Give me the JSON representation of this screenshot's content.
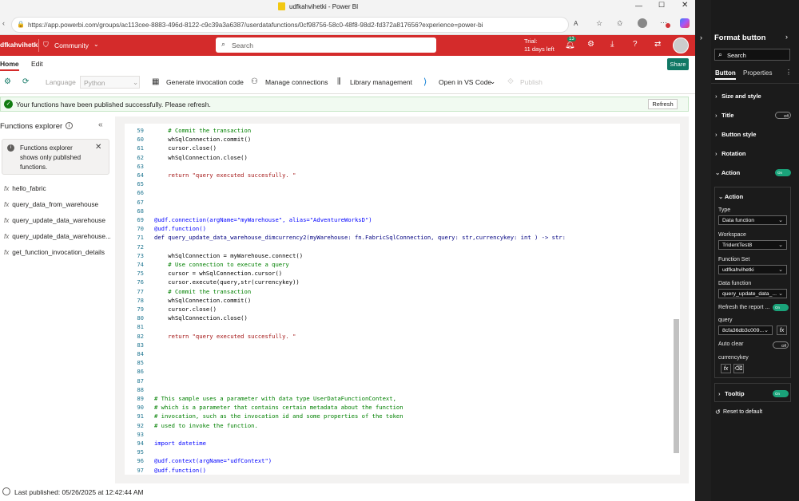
{
  "window": {
    "title": "udfkahvihetki - Power BI"
  },
  "browser": {
    "url": "https://app.powerbi.com/groups/ac113cee-8883-496d-8122-c9c39a3a6387/userdatafunctions/0cf98756-58c0-48f8-98d2-fd372a817656?experience=power-bi",
    "notify_count": "13"
  },
  "appbar": {
    "workspace": "dfkahvihetki",
    "community": "Community",
    "search_placeholder": "Search",
    "trial_line1": "Trial:",
    "trial_line2": "11 days left",
    "notif_count": "13",
    "share": "Share"
  },
  "menu": {
    "home": "Home",
    "edit": "Edit"
  },
  "ribbon": {
    "language_label": "Language",
    "language_value": "Python",
    "generate": "Generate invocation code",
    "connections": "Manage connections",
    "library": "Library management",
    "vscode": "Open in VS Code",
    "publish": "Publish"
  },
  "banner": {
    "text": "Your functions have been published successfully. Please refresh.",
    "refresh": "Refresh"
  },
  "explorer": {
    "title": "Functions explorer",
    "info": [
      "Functions explorer",
      "shows only published",
      "functions."
    ],
    "functions": [
      "hello_fabric",
      "query_data_from_warehouse",
      "query_update_data_warehouse",
      "query_update_data_warehouse...",
      "get_function_invocation_details"
    ]
  },
  "code": [
    {
      "n": "59",
      "t": "    # Commit the transaction",
      "k": "cm"
    },
    {
      "n": "60",
      "t": "    whSqlConnection.commit()",
      "k": ""
    },
    {
      "n": "61",
      "t": "    cursor.close()",
      "k": ""
    },
    {
      "n": "62",
      "t": "    whSqlConnection.close()",
      "k": ""
    },
    {
      "n": "63",
      "t": "",
      "k": ""
    },
    {
      "n": "64",
      "t": "    return \"query executed succesfully. \"",
      "k": "ret"
    },
    {
      "n": "65",
      "t": "",
      "k": ""
    },
    {
      "n": "66",
      "t": "",
      "k": ""
    },
    {
      "n": "67",
      "t": "",
      "k": ""
    },
    {
      "n": "68",
      "t": "",
      "k": ""
    },
    {
      "n": "69",
      "t": "@udf.connection(argName=\"myWarehouse\", alias=\"AdventureWorksD\")",
      "k": "dec"
    },
    {
      "n": "70",
      "t": "@udf.function()",
      "k": "dec"
    },
    {
      "n": "71",
      "t": "def query_update_data_warehouse_dimcurrency2(myWarehouse: fn.FabricSqlConnection, query: str,currencykey: int ) -> str:",
      "k": "def"
    },
    {
      "n": "72",
      "t": "",
      "k": ""
    },
    {
      "n": "73",
      "t": "    whSqlConnection = myWarehouse.connect()",
      "k": ""
    },
    {
      "n": "74",
      "t": "    # Use connection to execute a query",
      "k": "cm"
    },
    {
      "n": "75",
      "t": "    cursor = whSqlConnection.cursor()",
      "k": ""
    },
    {
      "n": "76",
      "t": "    cursor.execute(query,str(currencykey))",
      "k": ""
    },
    {
      "n": "77",
      "t": "    # Commit the transaction",
      "k": "cm"
    },
    {
      "n": "78",
      "t": "    whSqlConnection.commit()",
      "k": ""
    },
    {
      "n": "79",
      "t": "    cursor.close()",
      "k": ""
    },
    {
      "n": "80",
      "t": "    whSqlConnection.close()",
      "k": ""
    },
    {
      "n": "81",
      "t": "",
      "k": ""
    },
    {
      "n": "82",
      "t": "    return \"query executed succesfully. \"",
      "k": "ret"
    },
    {
      "n": "83",
      "t": "",
      "k": ""
    },
    {
      "n": "84",
      "t": "",
      "k": ""
    },
    {
      "n": "85",
      "t": "",
      "k": ""
    },
    {
      "n": "86",
      "t": "",
      "k": ""
    },
    {
      "n": "87",
      "t": "",
      "k": ""
    },
    {
      "n": "88",
      "t": "",
      "k": ""
    },
    {
      "n": "89",
      "t": "# This sample uses a parameter with data type UserDataFunctionContext,",
      "k": "cm"
    },
    {
      "n": "90",
      "t": "# which is a parameter that contains certain metadata about the function",
      "k": "cm"
    },
    {
      "n": "91",
      "t": "# invocation, such as the invocation id and some properties of the token",
      "k": "cm"
    },
    {
      "n": "92",
      "t": "# used to invoke the function.",
      "k": "cm"
    },
    {
      "n": "93",
      "t": "",
      "k": ""
    },
    {
      "n": "94",
      "t": "import datetime",
      "k": "imp"
    },
    {
      "n": "95",
      "t": "",
      "k": ""
    },
    {
      "n": "96",
      "t": "@udf.context(argName=\"udfContext\")",
      "k": "dec"
    },
    {
      "n": "97",
      "t": "@udf.function()",
      "k": "dec"
    }
  ],
  "status": {
    "text": "Last published: 05/26/2025 at 12:42:44 AM"
  },
  "pane": {
    "title": "Format button",
    "search": "Search",
    "tab_button": "Button",
    "tab_properties": "Properties",
    "size_style": "Size and style",
    "title_sec": "Title",
    "button_style": "Button style",
    "rotation": "Rotation",
    "action": "Action",
    "action_inner": "Action",
    "type_label": "Type",
    "type_value": "Data function",
    "workspace_label": "Workspace",
    "workspace_value": "TridentTest8",
    "fnset_label": "Function Set",
    "fnset_value": "udfkahvihetki",
    "datafn_label": "Data function",
    "datafn_value": "query_update_data_...",
    "refresh_label": "Refresh the report ...",
    "query_label": "query",
    "query_value": "8cfa36db3c009...",
    "autoclear_label": "Auto clear",
    "currencykey_label": "currencykey",
    "tooltip": "Tooltip",
    "reset": "Reset to default",
    "on": "On",
    "off": "Off"
  }
}
